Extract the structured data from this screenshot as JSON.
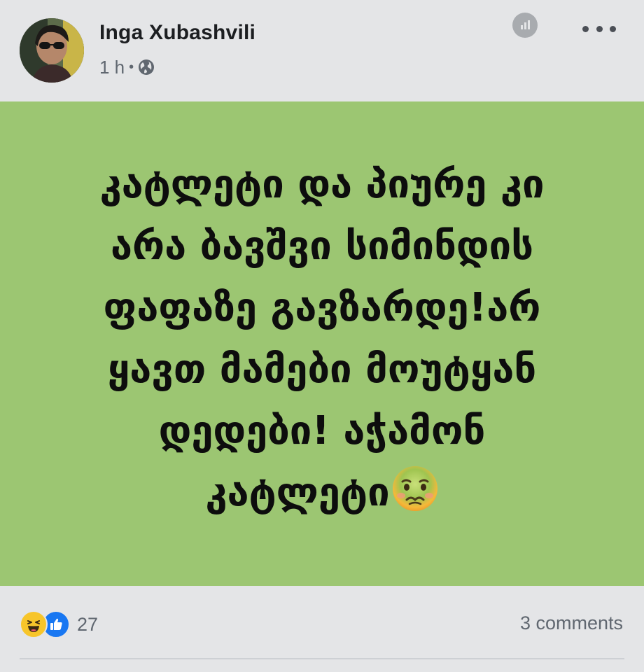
{
  "post": {
    "author": "Inga Xubashvili",
    "time": "1 h",
    "separator": "•",
    "privacy_icon": "globe-icon",
    "background_color": "#9cc672",
    "text_lines": [
      "კატლეტი და პიურე კი",
      "არა ბავშვი სიმინდის",
      "ფაფაზე გავზარდე!არ",
      "ყავთ მამები მოუტყან",
      "დედები! აჭამონ",
      "კატლეტი"
    ],
    "emoji": "nauseated-face"
  },
  "header": {
    "insights_icon": "insights-icon",
    "more_icon": "more-options-icon"
  },
  "footer": {
    "reaction_icons": [
      "haha-icon",
      "like-icon"
    ],
    "reaction_count": "27",
    "comments": "3 comments"
  },
  "colors": {
    "like_blue": "#1877f2",
    "haha_yellow": "#f7c52a",
    "meta_gray": "#606770"
  }
}
